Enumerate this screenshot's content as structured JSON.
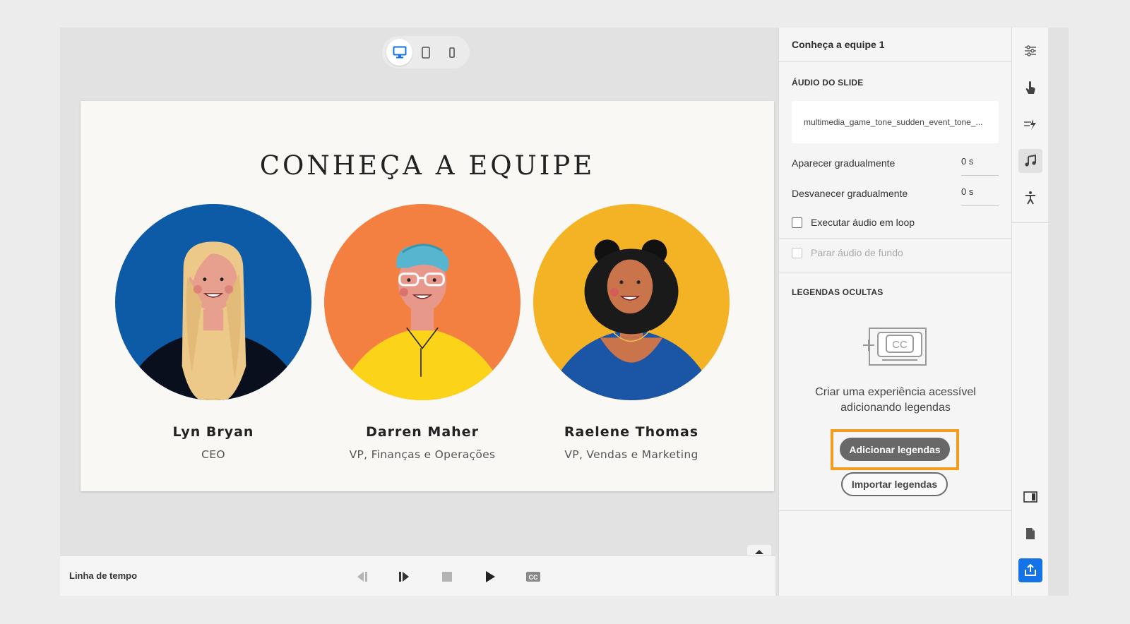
{
  "canvas": {
    "device_toggle": {
      "items": [
        {
          "name": "desktop-icon",
          "active": true
        },
        {
          "name": "tablet-icon",
          "active": false
        },
        {
          "name": "mobile-icon",
          "active": false
        }
      ]
    },
    "slide": {
      "title": "CONHEÇA A EQUIPE",
      "members": [
        {
          "name": "Lyn Bryan",
          "role": "CEO",
          "bg_color": "#0d5ba6"
        },
        {
          "name": "Darren Maher",
          "role": "VP, Finanças e Operações",
          "bg_color": "#f38040"
        },
        {
          "name": "Raelene Thomas",
          "role": "VP, Vendas e Marketing",
          "bg_color": "#f3b324"
        }
      ]
    }
  },
  "timeline": {
    "label": "Linha de tempo",
    "controls": [
      "previous-slide-icon",
      "next-frame-icon",
      "stop-icon",
      "play-icon",
      "closed-captions-icon"
    ]
  },
  "panel": {
    "title": "Conheça a equipe 1",
    "audio": {
      "section_title": "ÁUDIO DO SLIDE",
      "file_name": "multimedia_game_tone_sudden_event_tone_...",
      "fade_in_label": "Aparecer gradualmente",
      "fade_in_value": "0 s",
      "fade_out_label": "Desvanecer gradualmente",
      "fade_out_value": "0 s",
      "loop_label": "Executar áudio em loop",
      "loop_checked": false,
      "stop_bg_label": "Parar áudio de fundo",
      "stop_bg_checked": false,
      "stop_bg_disabled": true
    },
    "captions": {
      "section_title": "LEGENDAS OCULTAS",
      "description": "Criar uma experiência acessível adicionando legendas",
      "add_button": "Adicionar legendas",
      "import_button": "Importar legendas",
      "highlight_color": "#f39c1e"
    }
  },
  "rail": {
    "icons": [
      "properties-sliders-icon",
      "interaction-hand-icon",
      "animation-icon",
      "audio-note-icon",
      "accessibility-icon",
      "panel-layout-icon",
      "document-icon",
      "share-export-icon"
    ],
    "active": "audio-note-icon",
    "accent_color": "#1473e6"
  }
}
